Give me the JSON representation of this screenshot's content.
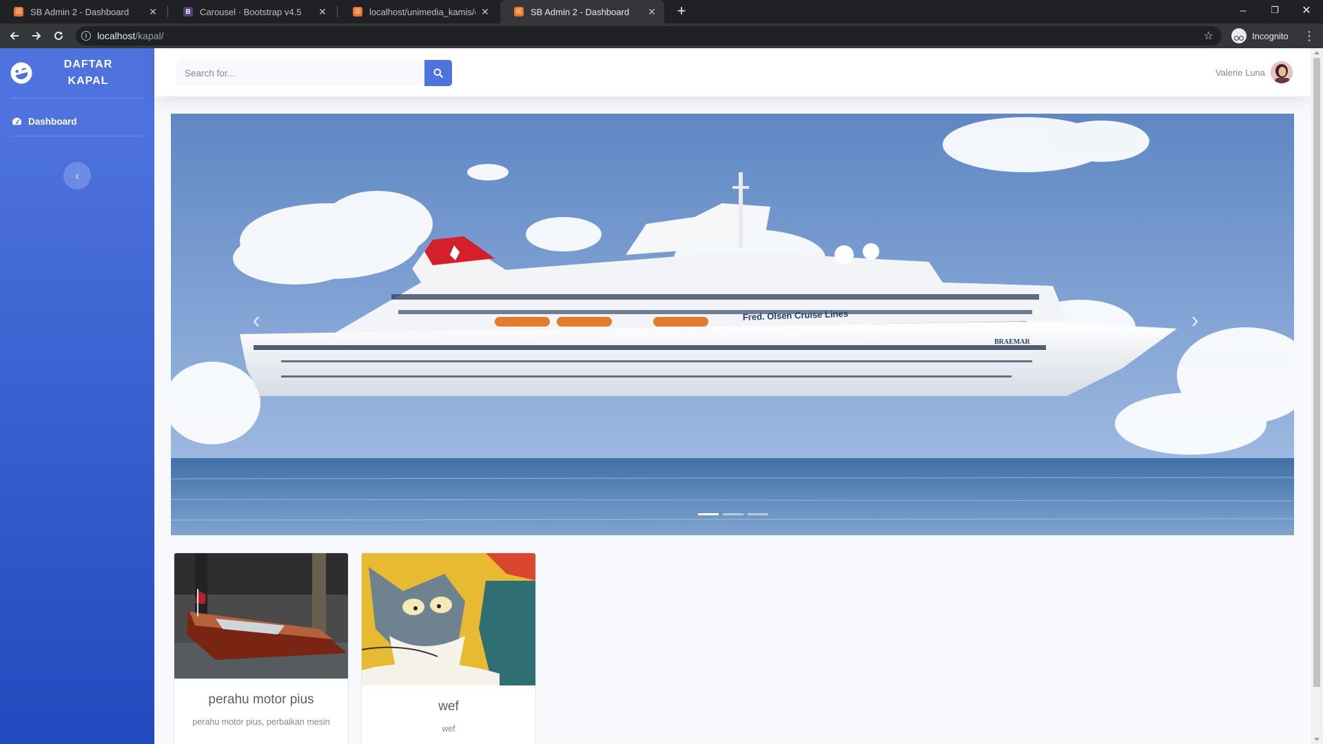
{
  "browser": {
    "tabs": [
      {
        "title": "SB Admin 2 - Dashboard",
        "icon": "xampp-icon"
      },
      {
        "title": "Carousel · Bootstrap v4.5",
        "icon": "bootstrap-icon"
      },
      {
        "title": "localhost/unimedia_kamis/edit_fr",
        "icon": "xampp-icon"
      },
      {
        "title": "SB Admin 2 - Dashboard",
        "icon": "xampp-icon",
        "active": true
      }
    ],
    "url_host": "localhost",
    "url_path": "/kapal/",
    "incognito_label": "Incognito"
  },
  "sidebar": {
    "brand": "DAFTAR KAPAL",
    "items": [
      {
        "label": "Dashboard",
        "icon": "tachometer-icon"
      }
    ]
  },
  "topbar": {
    "search_placeholder": "Search for...",
    "user_name": "Valerie Luna"
  },
  "carousel": {
    "active_slide": 1,
    "slide_count": 3,
    "ship_text_1": "Fred. Olsen Cruise Lines",
    "ship_text_2": "BRAEMAR"
  },
  "cards": [
    {
      "title": "perahu motor pius",
      "text": "perahu motor pius, perbaikan mesin"
    },
    {
      "title": "wef",
      "text": "wef"
    }
  ],
  "colors": {
    "primary": "#4e73df",
    "sidebar_end": "#224abe"
  }
}
